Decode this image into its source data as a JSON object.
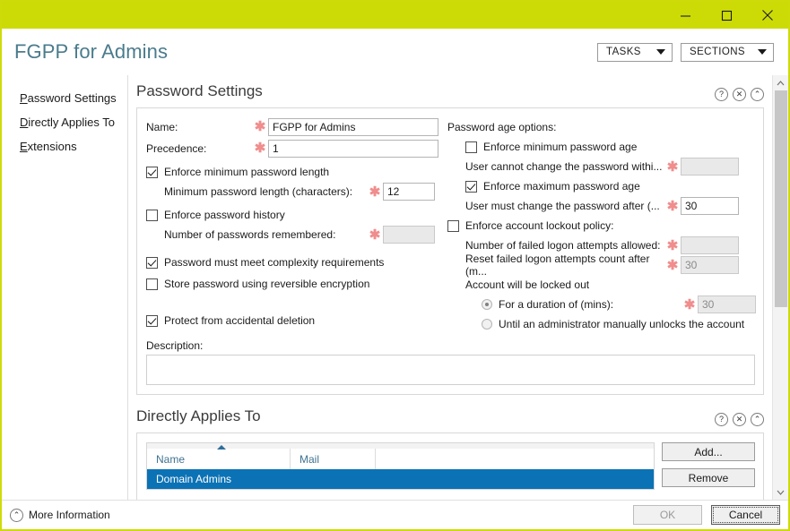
{
  "window": {
    "title_bar_color": "#ccdb05",
    "accent_blue": "#0b72b5",
    "required_star_color": "#f08d8d",
    "minimize": "minimize-icon",
    "maximize": "maximize-icon",
    "close": "close-icon"
  },
  "header": {
    "app_title": "FGPP for Admins",
    "tasks_button": "TASKS",
    "sections_button": "SECTIONS"
  },
  "sidebar": {
    "items": [
      {
        "label": "Password Settings",
        "accel": "P",
        "rest": "assword Settings"
      },
      {
        "label": "Directly Applies To",
        "accel": "D",
        "rest": "irectly Applies To"
      },
      {
        "label": "Extensions",
        "accel": "E",
        "rest": "xtensions"
      }
    ]
  },
  "password_settings": {
    "section_title": "Password Settings",
    "help_icon": "?",
    "close_icon": "✕",
    "collapse_icon": "⌃",
    "name_label": "Name:",
    "name_value": "FGPP for Admins",
    "precedence_label": "Precedence:",
    "precedence_value": "1",
    "enforce_min_length_label": "Enforce minimum password length",
    "enforce_min_length_checked": true,
    "min_length_label": "Minimum password length (characters):",
    "min_length_value": "12",
    "enforce_history_label": "Enforce password history",
    "enforce_history_checked": false,
    "history_label": "Number of passwords remembered:",
    "history_value": "",
    "complexity_label": "Password must meet complexity requirements",
    "complexity_checked": true,
    "reversible_label": "Store password using reversible encryption",
    "reversible_checked": false,
    "protect_label": "Protect from accidental deletion",
    "protect_checked": true,
    "description_label": "Description:",
    "description_value": "",
    "age_options_label": "Password age options:",
    "enforce_min_age_label": "Enforce minimum password age",
    "enforce_min_age_checked": false,
    "min_age_label": "User cannot change the password withi...",
    "min_age_value": "",
    "enforce_max_age_label": "Enforce maximum password age",
    "enforce_max_age_checked": true,
    "max_age_label": "User must change the password after (...",
    "max_age_value": "30",
    "lockout_policy_label": "Enforce account lockout policy:",
    "lockout_policy_checked": false,
    "failed_attempts_label": "Number of failed logon attempts allowed:",
    "failed_attempts_value": "",
    "reset_count_label": "Reset failed logon attempts count after (m...",
    "reset_count_value": "30",
    "locked_out_label": "Account will be locked out",
    "duration_radio_label": "For a duration of (mins):",
    "duration_radio_selected": true,
    "duration_value": "30",
    "until_admin_radio_label": "Until an administrator manually unlocks the account",
    "until_admin_selected": false
  },
  "directly_applies_to": {
    "section_title": "Directly Applies To",
    "help_icon": "?",
    "close_icon": "✕",
    "collapse_icon": "⌃",
    "columns": [
      "Name",
      "Mail",
      ""
    ],
    "sort_column": "Name",
    "sort_direction": "ascending",
    "rows": [
      {
        "name": "Domain Admins",
        "mail": "",
        "selected": true
      }
    ],
    "add_button": "Add...",
    "remove_button": "Remove"
  },
  "footer": {
    "more_information": "More Information",
    "more_info_icon": "⌃",
    "ok_button": "OK",
    "ok_disabled": true,
    "cancel_button": "Cancel",
    "cancel_focused": true
  },
  "scrollbar": {
    "up_arrow": "⌃",
    "down_arrow": "⌄",
    "thumb_percent": 55
  }
}
